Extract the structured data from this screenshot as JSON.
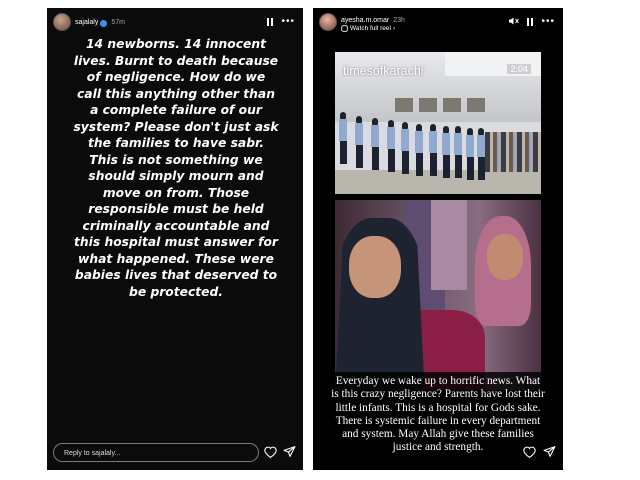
{
  "story_left": {
    "username": "sajalaly",
    "time": "57m",
    "text": "14 newborns. 14 innocent lives. Burnt to death because of negligence. How do we call this anything other than a complete failure of our system? Please don't just ask the families to have sabr. This is not something we should simply mourn and move on from. Those responsible must be held criminally accountable and this hospital must answer for what happened. These were babies lives that deserved to be protected.",
    "reply_placeholder": "Reply to sajalaly..."
  },
  "story_right": {
    "username": "ayesha.m.omar",
    "time": "23h",
    "watch_label": "Watch full reel",
    "video_watermark": "timesofkarachi",
    "video_time": "2:04",
    "caption": "Everyday we wake up to horrific news. What is this crazy negligence? Parents have lost their little infants. This is a hospital for Gods sake. There is systemic failure in every department and system. May Allah give these families justice and strength."
  },
  "icons": {
    "pause": "pause-icon",
    "more": "more-options-icon",
    "verified": "verified-badge-icon",
    "heart": "heart-icon",
    "send": "send-icon",
    "mute": "mute-icon",
    "chevron": "chevron-right-icon"
  },
  "colors": {
    "story_bg": "#0b0b0b",
    "verified_blue": "#3797f0",
    "caption_bg": "#000000"
  }
}
